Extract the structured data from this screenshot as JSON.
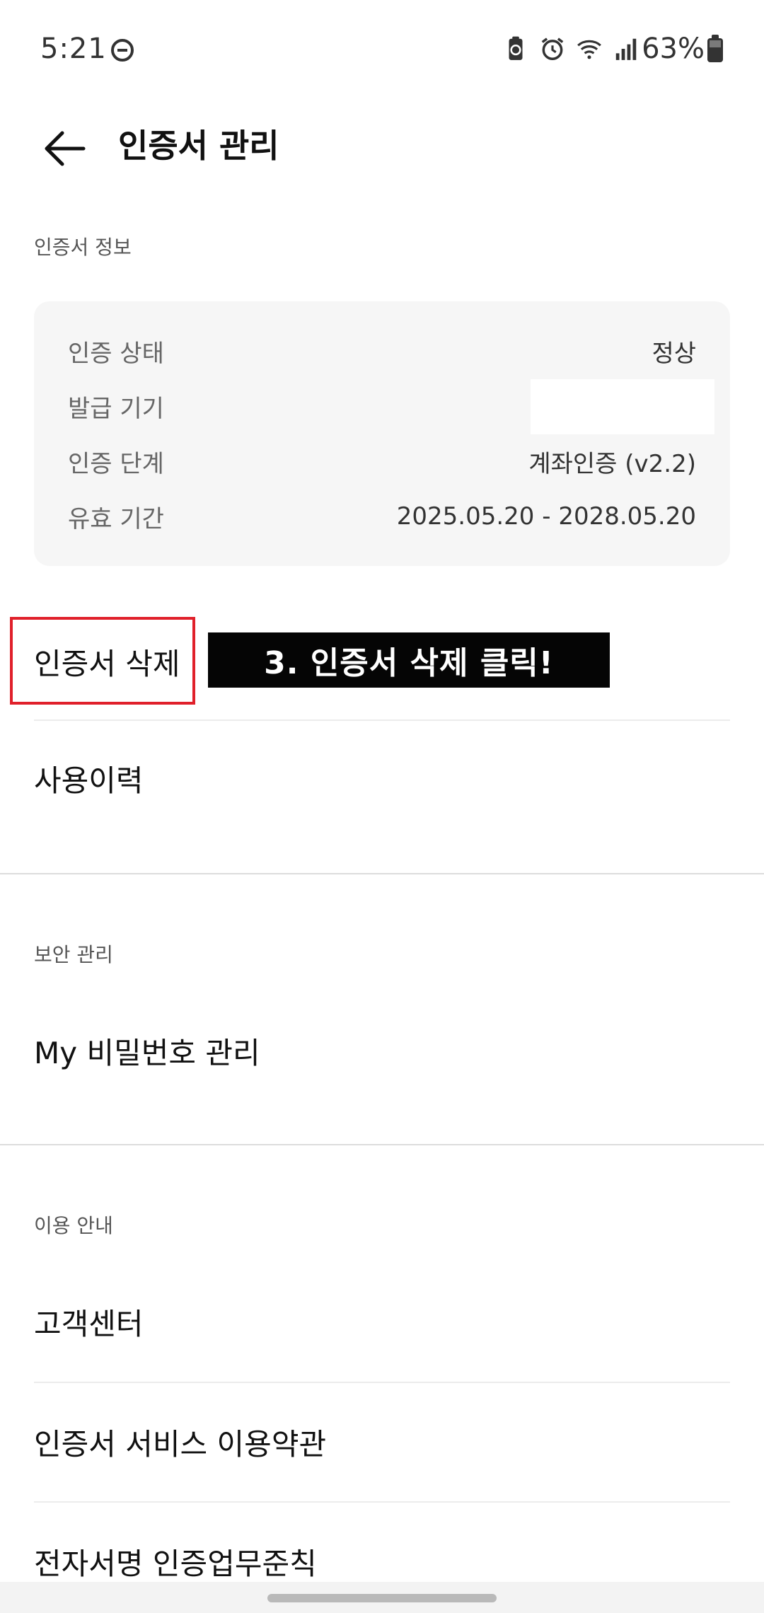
{
  "status_bar": {
    "time": "5:21",
    "battery_percent": "63%",
    "icons": [
      "dnd-icon",
      "battery-saver-icon",
      "alarm-icon",
      "wifi-icon",
      "signal-icon",
      "battery-icon"
    ]
  },
  "header": {
    "back_icon": "back-arrow-icon",
    "title": "인증서 관리"
  },
  "cert_info": {
    "section_label": "인증서 정보",
    "rows": [
      {
        "label": "인증 상태",
        "value": "정상"
      },
      {
        "label": "발급 기기",
        "value": ""
      },
      {
        "label": "인증 단계",
        "value": "계좌인증 (v2.2)"
      },
      {
        "label": "유효 기간",
        "value": "2025.05.20 - 2028.05.20"
      }
    ]
  },
  "cert_actions": [
    {
      "label": "인증서 삭제"
    },
    {
      "label": "사용이력"
    }
  ],
  "annotation": {
    "text": "3. 인증서 삭제 클릭!",
    "highlight_color": "#e0202a"
  },
  "security": {
    "section_label": "보안 관리",
    "items": [
      {
        "label": "My 비밀번호 관리"
      }
    ]
  },
  "guide": {
    "section_label": "이용 안내",
    "items": [
      {
        "label": "고객센터"
      },
      {
        "label": "인증서 서비스 이용약관"
      },
      {
        "label": "전자서명 인증업무준칙"
      }
    ]
  }
}
